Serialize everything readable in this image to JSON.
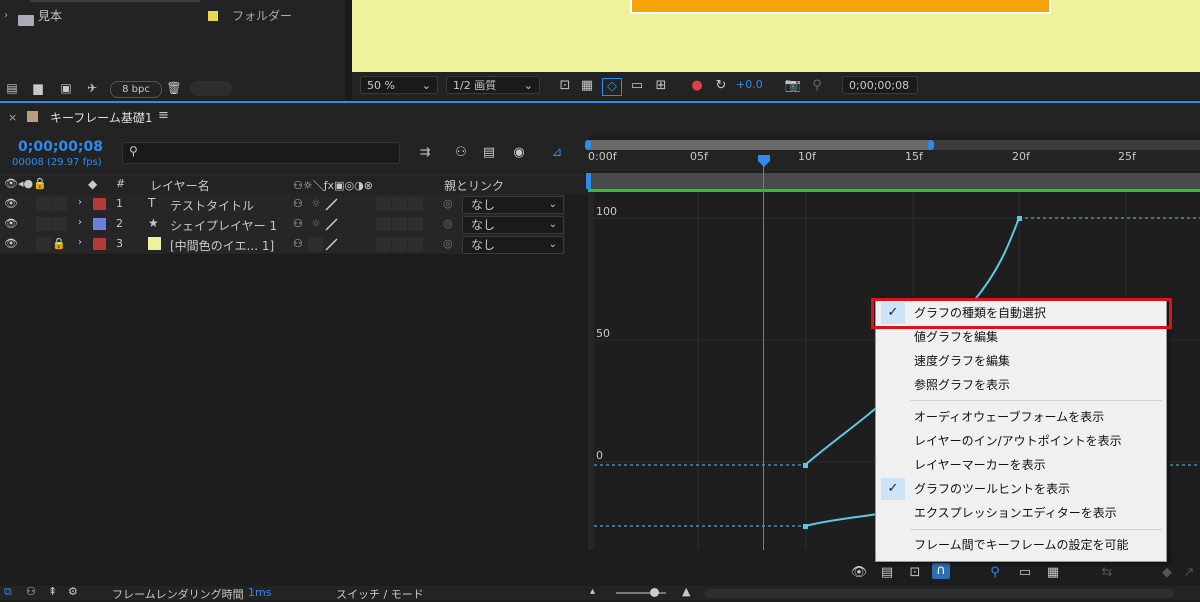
{
  "project": {
    "row2_name": "見本",
    "row2_type": "フォルダー",
    "bpc": "8 bpc"
  },
  "viewer": {
    "zoom": "50 %",
    "resolution": "1/2 画質",
    "exposure": "+0.0",
    "timecode": "0;00;00;08"
  },
  "timeline": {
    "comp_name": "キーフレーム基礎1",
    "current_time": "0;00;00;08",
    "current_frame": "00008 (29.97 fps)",
    "search_placeholder": "",
    "col_layer_name": "レイヤー名",
    "col_parent": "親とリンク",
    "ticks": [
      "0:00f",
      "05f",
      "10f",
      "15f",
      "20f",
      "25f"
    ],
    "graph_y_labels": [
      "100",
      "50",
      "0"
    ],
    "layers": [
      {
        "num": "1",
        "type": "T",
        "name": "テストタイトル",
        "parent": "なし",
        "color": "#b53a3a"
      },
      {
        "num": "2",
        "type": "★",
        "name": "シェイプレイヤー 1",
        "parent": "なし",
        "color": "#6a7fe0"
      },
      {
        "num": "3",
        "type": "",
        "name": "[中間色のイエ... 1]",
        "parent": "なし",
        "color": "#b53a3a"
      }
    ],
    "bottom_render_label": "フレームレンダリング時間",
    "bottom_render_value": "1ms",
    "bottom_switch_mode": "スイッチ / モード"
  },
  "menu": {
    "items": [
      {
        "label": "グラフの種類を自動選択",
        "checked": true
      },
      {
        "label": "値グラフを編集",
        "checked": false
      },
      {
        "label": "速度グラフを編集",
        "checked": false
      },
      {
        "label": "参照グラフを表示",
        "checked": false
      },
      {
        "label": "オーディオウェーブフォームを表示",
        "checked": false
      },
      {
        "label": "レイヤーのイン/アウトポイントを表示",
        "checked": false
      },
      {
        "label": "レイヤーマーカーを表示",
        "checked": false
      },
      {
        "label": "グラフのツールヒントを表示",
        "checked": true
      },
      {
        "label": "エクスプレッションエディターを表示",
        "checked": false
      },
      {
        "label": "フレーム間でキーフレームの設定を可能",
        "checked": false
      }
    ],
    "check_glyph": "✓"
  },
  "colors": {
    "accent": "#2d8ceb",
    "highlight": "#e0101a",
    "viewer_bg": "#eef29a",
    "comp_orange": "#f9a30c",
    "curve": "#5fc8e0"
  }
}
